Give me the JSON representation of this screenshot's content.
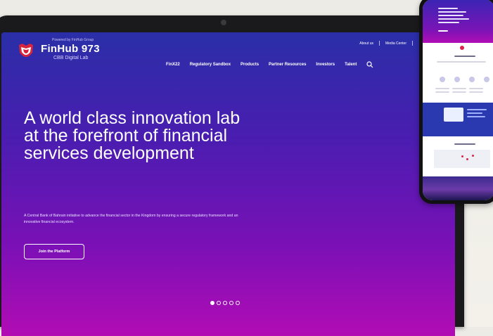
{
  "site": {
    "logo_tagline": "Powered by FinHub Group",
    "logo_name": "FinHub 973",
    "logo_sub": "CBB Digital Lab",
    "utility_links": [
      "About us",
      "Media Center"
    ],
    "nav_items": [
      "FinX22",
      "Regulatory Sandbox",
      "Products",
      "Partner Resources",
      "Investors",
      "Talent"
    ],
    "hero_title": "A world class innovation lab at the forefront of financial services development",
    "hero_description": "A Central Bank of Bahrain initiative to advance the financial sector in the Kingdom by ensuring a secure regulatory framework and an innovative financial ecosystem.",
    "cta_label": "Join the Platform",
    "slides_total": 5,
    "slides_active": 1
  },
  "icons": {
    "search": "search-icon",
    "emblem": "logo-emblem-icon"
  },
  "colors": {
    "hero_top": "#2a2fa8",
    "hero_bottom": "#b20cb4",
    "text": "#ffffff"
  }
}
